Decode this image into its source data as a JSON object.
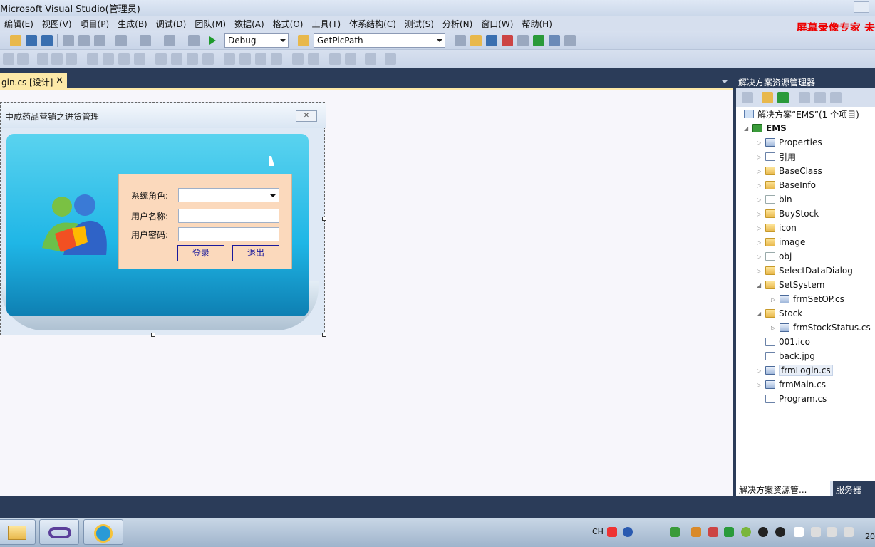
{
  "window": {
    "title": "Microsoft Visual Studio(管理员)",
    "watermark": "屏幕录像专家  未"
  },
  "menu": [
    "编辑(E)",
    "视图(V)",
    "项目(P)",
    "生成(B)",
    "调试(D)",
    "团队(M)",
    "数据(A)",
    "格式(O)",
    "工具(T)",
    "体系结构(C)",
    "测试(S)",
    "分析(N)",
    "窗口(W)",
    "帮助(H)"
  ],
  "toolbar": {
    "config": "Debug",
    "find": "GetPicPath"
  },
  "doc_tab": {
    "label": "gin.cs [设计]",
    "close": "✕"
  },
  "form": {
    "title": "中成药品营销之进货管理",
    "close": "✕",
    "role_label": "系统角色:",
    "user_label": "用户名称:",
    "pwd_label": "用户密码:",
    "login": "登录",
    "exit": "退出"
  },
  "solution_explorer": {
    "title": "解决方案资源管理器",
    "solution": "解决方案“EMS”(1 个项目)",
    "project": "EMS",
    "items": [
      {
        "label": "Properties",
        "icon": "properties-folder",
        "level": 1,
        "arrow": "▷"
      },
      {
        "label": "引用",
        "icon": "references",
        "level": 1,
        "arrow": "▷"
      },
      {
        "label": "BaseClass",
        "icon": "folder",
        "level": 1,
        "arrow": "▷"
      },
      {
        "label": "BaseInfo",
        "icon": "folder",
        "level": 1,
        "arrow": "▷"
      },
      {
        "label": "bin",
        "icon": "folder-empty",
        "level": 1,
        "arrow": "▷"
      },
      {
        "label": "BuyStock",
        "icon": "folder",
        "level": 1,
        "arrow": "▷"
      },
      {
        "label": "icon",
        "icon": "folder",
        "level": 1,
        "arrow": "▷"
      },
      {
        "label": "image",
        "icon": "folder",
        "level": 1,
        "arrow": "▷"
      },
      {
        "label": "obj",
        "icon": "folder-empty",
        "level": 1,
        "arrow": "▷"
      },
      {
        "label": "SelectDataDialog",
        "icon": "folder",
        "level": 1,
        "arrow": "▷"
      },
      {
        "label": "SetSystem",
        "icon": "folder",
        "level": 1,
        "arrow": "◢"
      },
      {
        "label": "frmSetOP.cs",
        "icon": "form",
        "level": 2,
        "arrow": "▷"
      },
      {
        "label": "Stock",
        "icon": "folder",
        "level": 1,
        "arrow": "◢"
      },
      {
        "label": "frmStockStatus.cs",
        "icon": "form",
        "level": 2,
        "arrow": "▷"
      },
      {
        "label": "001.ico",
        "icon": "file",
        "level": 1,
        "arrow": ""
      },
      {
        "label": "back.jpg",
        "icon": "file",
        "level": 1,
        "arrow": ""
      },
      {
        "label": "frmLogin.cs",
        "icon": "form",
        "level": 1,
        "arrow": "▷"
      },
      {
        "label": "frmMain.cs",
        "icon": "form",
        "level": 1,
        "arrow": "▷"
      },
      {
        "label": "Program.cs",
        "icon": "cs-file",
        "level": 1,
        "arrow": ""
      }
    ],
    "bottom_tab1": "解决方案资源管...",
    "bottom_tab2": "服务器"
  },
  "taskbar": {
    "ime": "CH",
    "clock": "20"
  }
}
